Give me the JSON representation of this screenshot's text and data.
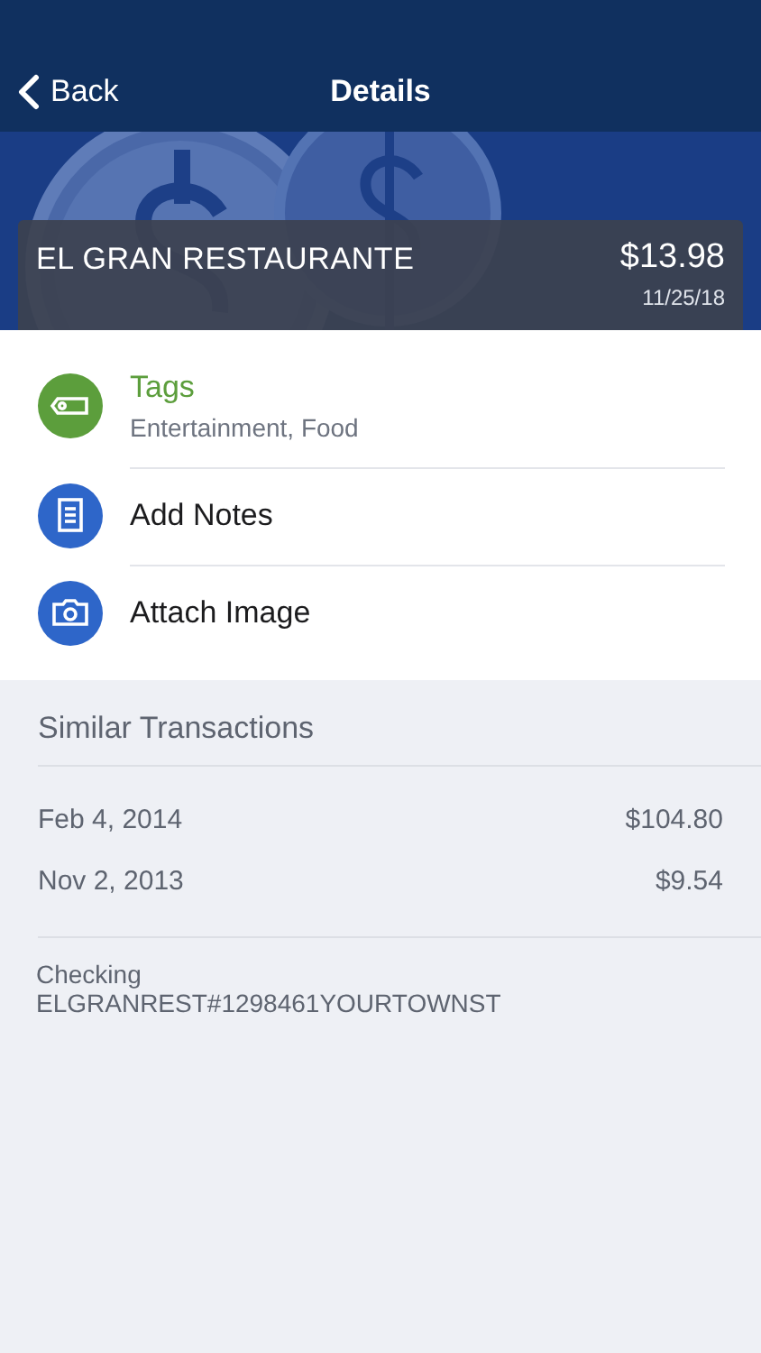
{
  "nav": {
    "back": "Back",
    "title": "Details"
  },
  "transaction": {
    "merchant": "EL GRAN RESTAURANTE",
    "amount": "$13.98",
    "date": "11/25/18"
  },
  "actions": [
    {
      "kind": "tags",
      "title": "Tags",
      "subtitle": "Entertainment, Food",
      "color": "#5c9e3c"
    },
    {
      "kind": "notes",
      "title": "Add Notes",
      "color": "#2e66c9"
    },
    {
      "kind": "camera",
      "title": "Attach Image",
      "color": "#2e66c9"
    }
  ],
  "similar": {
    "heading": "Similar Transactions",
    "rows": [
      {
        "date": "Feb 4, 2014",
        "amount": "$104.80"
      },
      {
        "date": "Nov 2, 2013",
        "amount": "$9.54"
      }
    ]
  },
  "account": {
    "name": "Checking",
    "description": "ELGRANREST#1298461YOURTOWNST"
  }
}
